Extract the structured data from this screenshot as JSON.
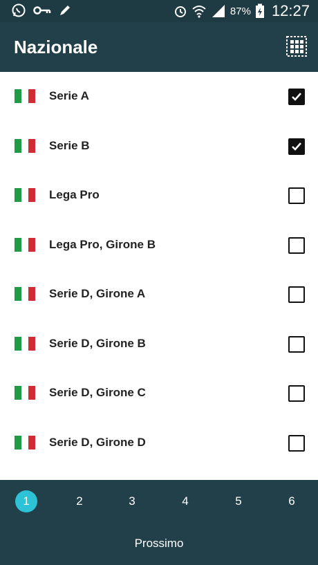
{
  "status_bar": {
    "battery": "87%",
    "time": "12:27",
    "icons": [
      "whatsapp-icon",
      "key-icon",
      "pen-icon",
      "alarm-icon",
      "wifi-icon",
      "signal-icon",
      "battery-charging-icon"
    ]
  },
  "appbar": {
    "title": "Nazionale",
    "grid_icon": "grid-view-icon"
  },
  "leagues": [
    {
      "label": "Serie A",
      "checked": true
    },
    {
      "label": "Serie B",
      "checked": true
    },
    {
      "label": "Lega Pro",
      "checked": false
    },
    {
      "label": "Lega Pro, Girone B",
      "checked": false
    },
    {
      "label": "Serie D, Girone A",
      "checked": false
    },
    {
      "label": "Serie D, Girone B",
      "checked": false
    },
    {
      "label": "Serie D, Girone C",
      "checked": false
    },
    {
      "label": "Serie D, Girone D",
      "checked": false
    }
  ],
  "flag_colors": [
    "#1e9b45",
    "#ffffff",
    "#d12b36"
  ],
  "pagination": {
    "pages": [
      "1",
      "2",
      "3",
      "4",
      "5",
      "6"
    ],
    "active": "1"
  },
  "next_label": "Prossimo",
  "colors": {
    "appbar": "#22404a",
    "status_bar": "#1e3a42",
    "accent": "#2ec2d6"
  }
}
